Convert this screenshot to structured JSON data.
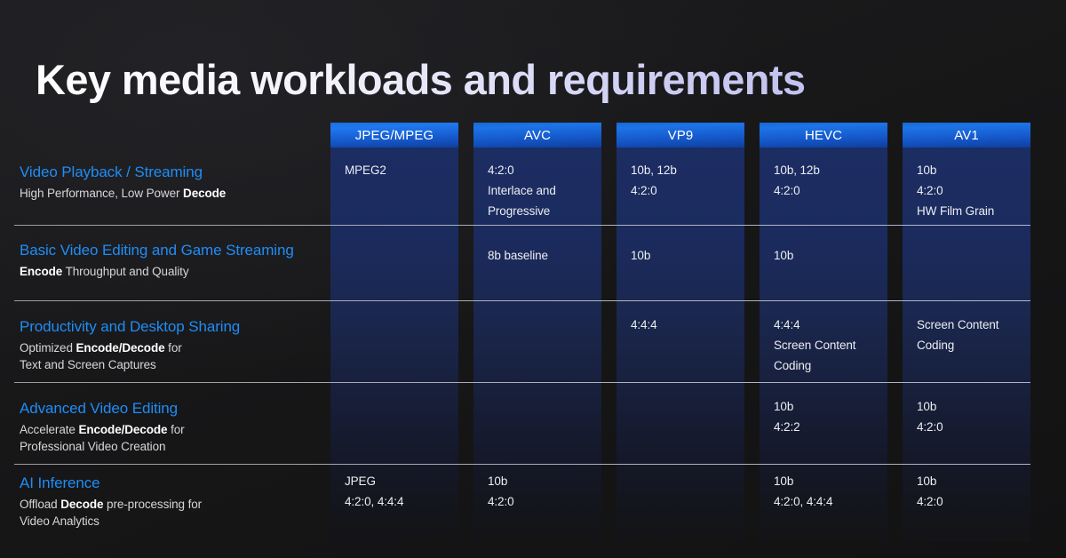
{
  "slide": {
    "title": "Key media workloads and requirements",
    "background_color": "#1a1a1b",
    "accent_color": "#1f8df5",
    "header_color": "#1d74e8"
  },
  "table": {
    "columns": [
      {
        "id": "jpeg-mpeg",
        "label": "JPEG/MPEG"
      },
      {
        "id": "avc",
        "label": "AVC"
      },
      {
        "id": "vp9",
        "label": "VP9"
      },
      {
        "id": "hevc",
        "label": "HEVC"
      },
      {
        "id": "av1",
        "label": "AV1"
      }
    ],
    "rows": [
      {
        "id": "video-playback-streaming",
        "title": "Video Playback / Streaming",
        "sub_prefix": "High Performance, Low Power ",
        "sub_bold": "Decode",
        "sub_suffix": "",
        "sub_line2": "",
        "cells": [
          "MPEG2",
          "4:2:0\nInterlace and\nProgressive",
          "10b, 12b\n4:2:0",
          "10b, 12b\n4:2:0",
          "10b\n4:2:0\nHW Film Grain"
        ]
      },
      {
        "id": "basic-video-editing-game-streaming",
        "title": "Basic Video Editing and Game Streaming",
        "sub_prefix": "",
        "sub_bold": "Encode",
        "sub_suffix": " Throughput and Quality",
        "sub_line2": "",
        "cells": [
          "",
          "8b baseline",
          "10b",
          "10b",
          ""
        ]
      },
      {
        "id": "productivity-desktop-sharing",
        "title": "Productivity and Desktop Sharing",
        "sub_prefix": "Optimized ",
        "sub_bold": "Encode/Decode",
        "sub_suffix": " for",
        "sub_line2": "Text and Screen Captures",
        "cells": [
          "",
          "",
          "4:4:4",
          "4:4:4\nScreen Content\nCoding",
          "Screen Content\nCoding"
        ]
      },
      {
        "id": "advanced-video-editing",
        "title": "Advanced Video Editing",
        "sub_prefix": "Accelerate ",
        "sub_bold": "Encode/Decode",
        "sub_suffix": " for",
        "sub_line2": "Professional Video Creation",
        "cells": [
          "",
          "",
          "",
          "10b\n4:2:2",
          "10b\n4:2:0"
        ]
      },
      {
        "id": "ai-inference",
        "title": "AI Inference",
        "sub_prefix": "Offload ",
        "sub_bold": "Decode",
        "sub_suffix": " pre-processing for",
        "sub_line2": "Video Analytics",
        "cells": [
          "JPEG\n4:2:0, 4:4:4",
          "10b\n4:2:0",
          "",
          "10b\n4:2:0, 4:4:4",
          "10b\n4:2:0"
        ]
      }
    ]
  }
}
